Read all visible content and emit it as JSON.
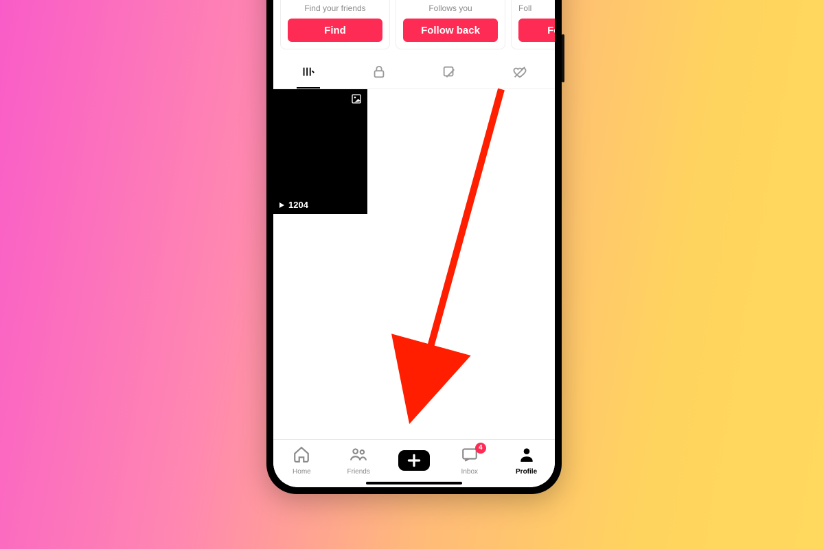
{
  "colors": {
    "accent": "#fe2c55"
  },
  "cards": [
    {
      "sub": "Find your friends",
      "btn": "Find"
    },
    {
      "sub": "Follows you",
      "btn": "Follow back"
    },
    {
      "sub": "Foll",
      "btn": "Follo"
    }
  ],
  "thumb": {
    "views": "1204"
  },
  "nav": {
    "home": "Home",
    "friends": "Friends",
    "inbox": "Inbox",
    "profile": "Profile",
    "inbox_badge": "4"
  }
}
